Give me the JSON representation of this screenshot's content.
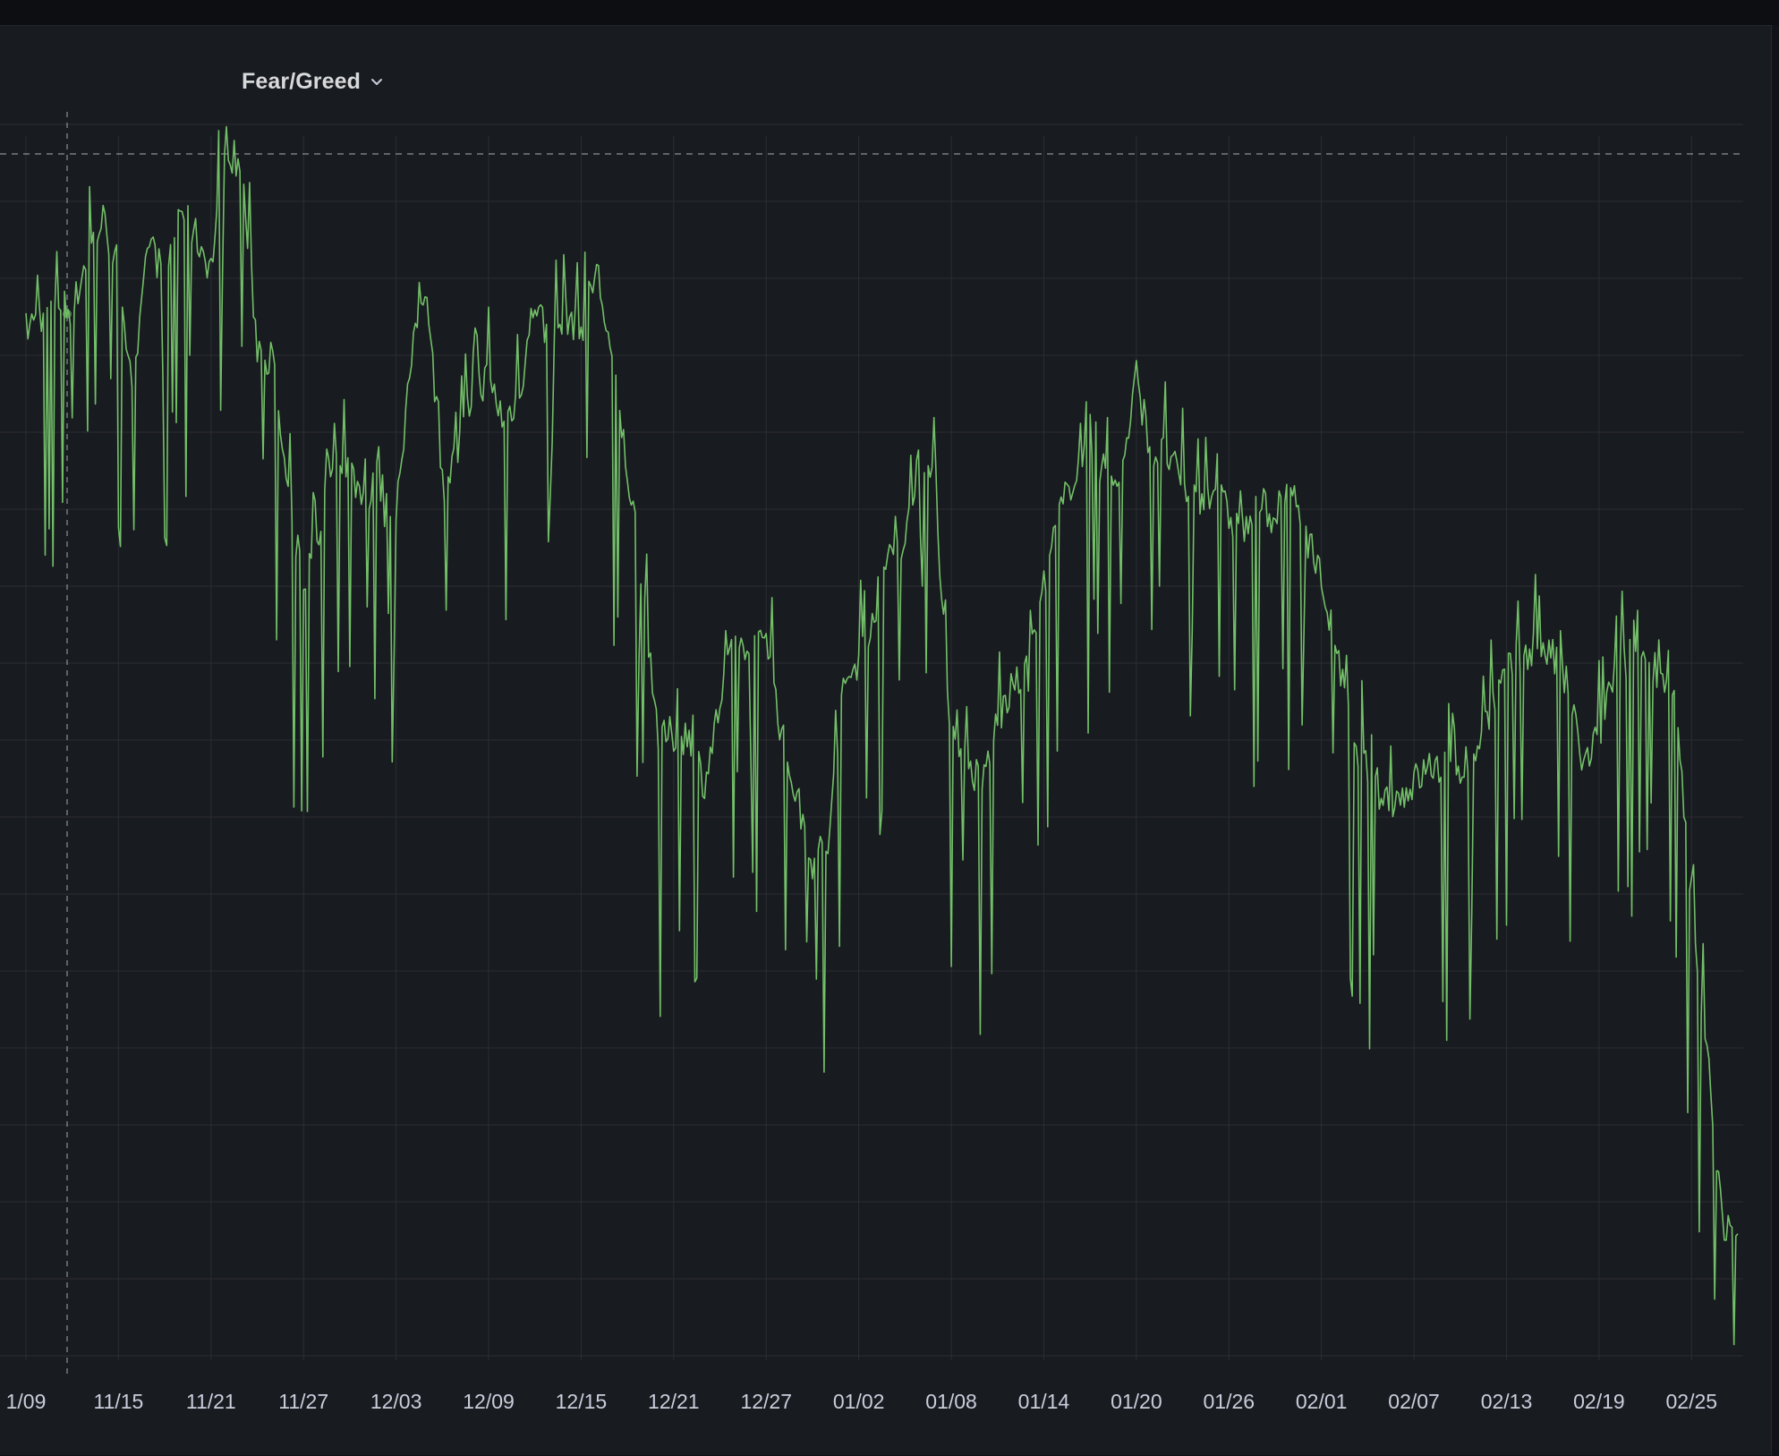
{
  "panel": {
    "title": "Fear/Greed"
  },
  "icons": {
    "title_menu": "chevron-down-icon"
  },
  "colors": {
    "background": "#181b1f",
    "page": "#111217",
    "series": "#73bf69",
    "grid": "#2b2e33",
    "tick_text": "#ccccdc",
    "threshold": "#8e9095",
    "crosshair": "#8e9095"
  },
  "chart_data": {
    "type": "line",
    "title": "Fear/Greed",
    "xlabel": "",
    "ylabel": "",
    "grid": true,
    "legend": "none",
    "x_ticks": [
      "1/09",
      "11/15",
      "11/21",
      "11/27",
      "12/03",
      "12/09",
      "12/15",
      "12/21",
      "12/27",
      "01/02",
      "01/08",
      "01/14",
      "01/20",
      "01/26",
      "02/01",
      "02/07",
      "02/13",
      "02/19",
      "02/25"
    ],
    "xlim": [
      "2024-11-09",
      "2025-02-28"
    ],
    "ylim": [
      0,
      80
    ],
    "threshold": 79,
    "crosshair_x": "2024-11-12",
    "series": [
      {
        "values": [
          [
            "2024-11-09",
            66
          ],
          [
            "2024-11-10",
            67
          ],
          [
            "2024-11-11",
            68
          ],
          [
            "2024-11-12",
            67
          ],
          [
            "2024-11-13",
            71
          ],
          [
            "2024-11-14",
            73
          ],
          [
            "2024-11-15",
            70
          ],
          [
            "2024-11-16",
            62
          ],
          [
            "2024-11-17",
            72
          ],
          [
            "2024-11-18",
            69
          ],
          [
            "2024-11-19",
            74
          ],
          [
            "2024-11-20",
            72
          ],
          [
            "2024-11-21",
            70
          ],
          [
            "2024-11-22",
            78
          ],
          [
            "2024-11-23",
            76
          ],
          [
            "2024-11-24",
            65
          ],
          [
            "2024-11-25",
            64
          ],
          [
            "2024-11-26",
            55
          ],
          [
            "2024-11-27",
            50
          ],
          [
            "2024-11-28",
            53
          ],
          [
            "2024-11-29",
            59
          ],
          [
            "2024-11-30",
            57
          ],
          [
            "2024-12-01",
            55
          ],
          [
            "2024-12-02",
            54
          ],
          [
            "2024-12-03",
            55
          ],
          [
            "2024-12-04",
            64
          ],
          [
            "2024-12-05",
            69
          ],
          [
            "2024-12-06",
            56
          ],
          [
            "2024-12-07",
            58
          ],
          [
            "2024-12-08",
            62
          ],
          [
            "2024-12-09",
            63
          ],
          [
            "2024-12-10",
            60
          ],
          [
            "2024-12-11",
            62
          ],
          [
            "2024-12-12",
            68
          ],
          [
            "2024-12-13",
            65
          ],
          [
            "2024-12-14",
            67
          ],
          [
            "2024-12-15",
            66
          ],
          [
            "2024-12-16",
            70
          ],
          [
            "2024-12-17",
            64
          ],
          [
            "2024-12-18",
            57
          ],
          [
            "2024-12-19",
            50
          ],
          [
            "2024-12-20",
            40
          ],
          [
            "2024-12-21",
            40
          ],
          [
            "2024-12-22",
            40
          ],
          [
            "2024-12-23",
            37
          ],
          [
            "2024-12-24",
            42
          ],
          [
            "2024-12-25",
            46
          ],
          [
            "2024-12-26",
            45
          ],
          [
            "2024-12-27",
            47
          ],
          [
            "2024-12-28",
            40
          ],
          [
            "2024-12-29",
            36
          ],
          [
            "2024-12-30",
            32
          ],
          [
            "2024-12-31",
            33
          ],
          [
            "2025-01-01",
            43
          ],
          [
            "2025-01-02",
            45
          ],
          [
            "2025-01-03",
            48
          ],
          [
            "2025-01-04",
            52
          ],
          [
            "2025-01-05",
            52
          ],
          [
            "2025-01-06",
            59
          ],
          [
            "2025-01-07",
            55
          ],
          [
            "2025-01-08",
            40
          ],
          [
            "2025-01-09",
            38
          ],
          [
            "2025-01-10",
            37
          ],
          [
            "2025-01-11",
            41
          ],
          [
            "2025-01-12",
            43
          ],
          [
            "2025-01-13",
            44
          ],
          [
            "2025-01-14",
            50
          ],
          [
            "2025-01-15",
            54
          ],
          [
            "2025-01-16",
            57
          ],
          [
            "2025-01-17",
            58
          ],
          [
            "2025-01-18",
            57
          ],
          [
            "2025-01-19",
            56
          ],
          [
            "2025-01-20",
            63
          ],
          [
            "2025-01-21",
            58
          ],
          [
            "2025-01-22",
            58
          ],
          [
            "2025-01-23",
            56
          ],
          [
            "2025-01-24",
            55
          ],
          [
            "2025-01-25",
            56
          ],
          [
            "2025-01-26",
            54
          ],
          [
            "2025-01-27",
            53
          ],
          [
            "2025-01-28",
            55
          ],
          [
            "2025-01-29",
            54
          ],
          [
            "2025-01-30",
            56
          ],
          [
            "2025-01-31",
            53
          ],
          [
            "2025-02-01",
            50
          ],
          [
            "2025-02-02",
            45
          ],
          [
            "2025-02-03",
            40
          ],
          [
            "2025-02-04",
            38
          ],
          [
            "2025-02-05",
            36
          ],
          [
            "2025-02-06",
            36
          ],
          [
            "2025-02-07",
            37
          ],
          [
            "2025-02-08",
            38
          ],
          [
            "2025-02-09",
            38
          ],
          [
            "2025-02-10",
            38
          ],
          [
            "2025-02-11",
            39
          ],
          [
            "2025-02-12",
            42
          ],
          [
            "2025-02-13",
            44
          ],
          [
            "2025-02-14",
            45
          ],
          [
            "2025-02-15",
            46
          ],
          [
            "2025-02-16",
            45
          ],
          [
            "2025-02-17",
            43
          ],
          [
            "2025-02-18",
            38
          ],
          [
            "2025-02-19",
            40
          ],
          [
            "2025-02-20",
            44
          ],
          [
            "2025-02-21",
            45
          ],
          [
            "2025-02-22",
            45
          ],
          [
            "2025-02-23",
            44
          ],
          [
            "2025-02-24",
            42
          ],
          [
            "2025-02-25",
            28
          ],
          [
            "2025-02-26",
            20
          ],
          [
            "2025-02-27",
            9
          ],
          [
            "2025-02-28",
            7
          ]
        ]
      }
    ]
  }
}
